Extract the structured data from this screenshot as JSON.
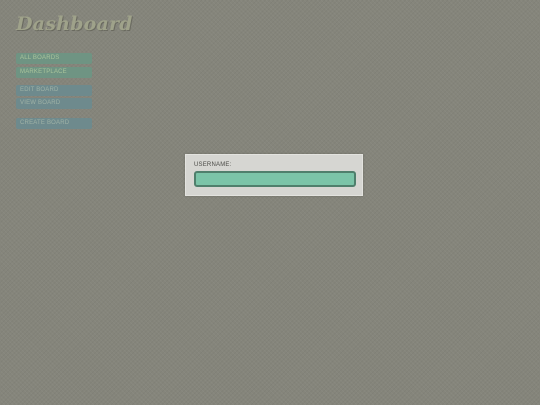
{
  "dashboard": {
    "title": "Dashboard"
  },
  "nav": {
    "items": [
      {
        "label": "ALL BOARDS",
        "style": "green"
      },
      {
        "label": "MARKETPLACE",
        "style": "green"
      },
      {
        "label": "EDIT BOARD",
        "style": "blue"
      },
      {
        "label": "VIEW BOARD",
        "style": "blue"
      },
      {
        "label": "CREATE BOARD",
        "style": "blue"
      }
    ]
  },
  "login": {
    "username_label": "USERNAME:",
    "username_value": "",
    "username_placeholder": ""
  },
  "colors": {
    "background": "#85857b",
    "panel": "#d6d6d2",
    "input_fill": "#7bc4a8",
    "input_border": "#4f7f6c",
    "nav_green": "#6f9483",
    "nav_blue": "#6e8a8d"
  }
}
